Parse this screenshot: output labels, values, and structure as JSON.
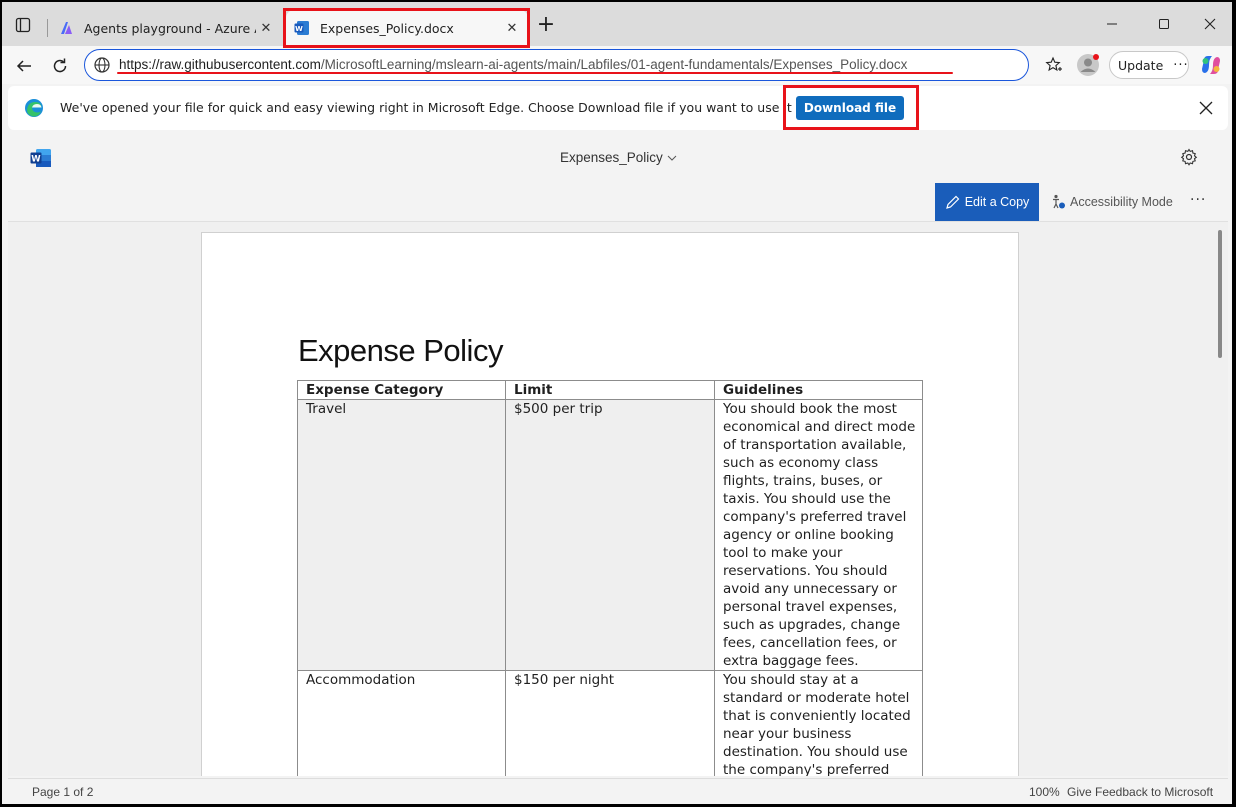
{
  "browser": {
    "tabs": [
      {
        "title": "Agents playground - Azure AI Fou",
        "icon": "azure-ai-foundry-icon",
        "active": false
      },
      {
        "title": "Expenses_Policy.docx",
        "icon": "word-doc-icon",
        "active": true
      }
    ],
    "address": {
      "url_host": "https://raw.githubusercontent.com",
      "url_path": "/MicrosoftLearning/mslearn-ai-agents/main/Labfiles/01-agent-fundamentals/Expenses_Policy.docx"
    },
    "update_label": "Update"
  },
  "infobar": {
    "message": "We've opened your file for quick and easy viewing right in Microsoft Edge. Choose Download file if you want to use it later.",
    "download_label": "Download file"
  },
  "viewer": {
    "doc_title": "Expenses_Policy",
    "edit_label": "Edit a Copy",
    "accessibility_label": "Accessibility Mode"
  },
  "document": {
    "heading": "Expense Policy",
    "table": {
      "headers": [
        "Expense Category",
        "Limit",
        "Guidelines"
      ],
      "rows": [
        {
          "category": "Travel",
          "limit": "$500 per trip",
          "guidelines": "You should book the most economical and direct mode of transportation available, such as economy class flights, trains, buses, or taxis. You should use the company's preferred travel agency or online booking tool to make your reservations. You should avoid any unnecessary or personal travel expenses, such as upgrades, change fees, cancellation fees, or extra baggage fees."
        },
        {
          "category": "Accommodation",
          "limit": "$150 per night",
          "guidelines": "You should stay at a standard or moderate hotel that is conveniently located near your business destination. You should use the company's preferred hotel booking tool or website to find the best rates"
        }
      ]
    }
  },
  "status": {
    "page": "Page 1 of 2",
    "zoom": "100%",
    "feedback": "Give Feedback to Microsoft"
  },
  "colors": {
    "accent_blue": "#0f6cbd",
    "annotation_red": "#e8131a"
  }
}
